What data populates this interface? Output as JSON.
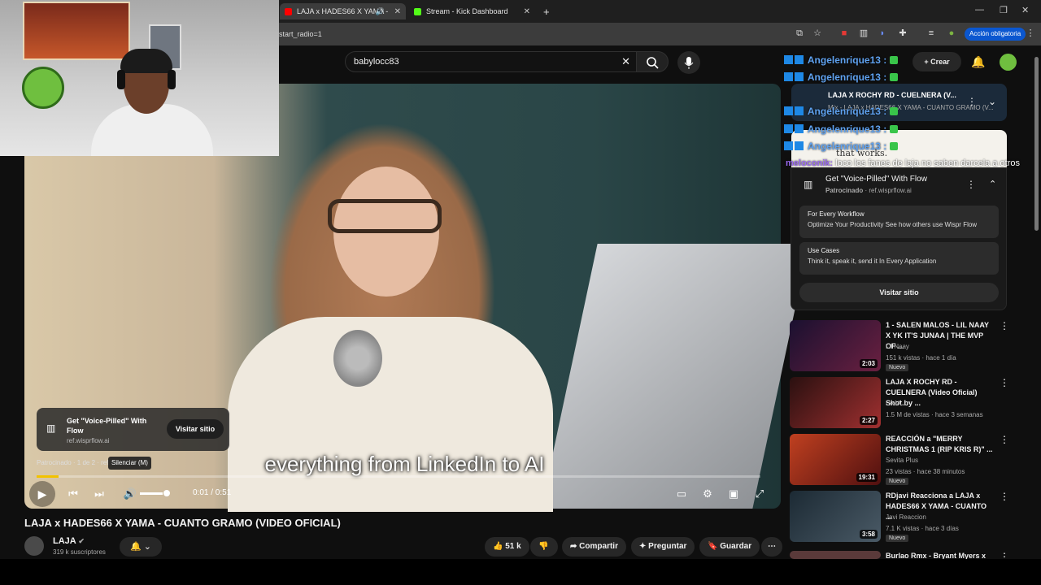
{
  "browser": {
    "tabs": [
      {
        "label": "LAJA x HADES66 X YAMA -",
        "active": true
      },
      {
        "label": "Stream - Kick Dashboard",
        "active": false
      }
    ],
    "url": "start_radio=1",
    "account_button": "Acción obligatoria"
  },
  "youtube": {
    "search_value": "babylocc83",
    "create_label": "Crear"
  },
  "player": {
    "caption": "everything from LinkedIn to AI",
    "time": "0:01 / 0:51",
    "progress": 0.03,
    "volume": 0.8,
    "tooltip": "Silenciar (M)",
    "sponsored_label": "Patrocinado · 1 de 2 · ref.wisprflow.ai",
    "ad_overlay": {
      "title": "Get \"Voice-Pilled\" With Flow",
      "url": "ref.wisprflow.ai",
      "button": "Visitar sitio"
    }
  },
  "video": {
    "title": "LAJA x HADES66 X YAMA - CUANTO GRAMO (VIDEO OFICIAL)",
    "channel": "LAJA",
    "subscribers": "319 k suscriptores",
    "likes": "51 k",
    "share": "Compartir",
    "ask": "Preguntar",
    "save": "Guardar"
  },
  "sidebar": {
    "now_playing": {
      "title": "LAJA X ROCHY RD - CUELNERA (V...",
      "subtitle": "Mix - LAJA x HADES66 X YAMA - CUANTO GRAMO (V..."
    },
    "ad_banner_text": "that works.",
    "ad_card": {
      "title": "Get \"Voice-Pilled\" With Flow",
      "sponsored": "Patrocinado",
      "domain": "ref.wisprflow.ai",
      "items": [
        {
          "title": "For Every Workflow",
          "desc": "Optimize Your Productivity See how others use Wispr Flow"
        },
        {
          "title": "Use Cases",
          "desc": "Think it, speak it, send it In Every Application"
        }
      ],
      "button": "Visitar sitio"
    },
    "recommendations": [
      {
        "title": "1 - SALEN MALOS - LIL NAAY X YK IT'S JUNAA | THE MVP OF ...",
        "channel": "Lil Naay",
        "meta": "151 k vistas · hace 1 día",
        "duration": "2:03",
        "badge": "Nuevo",
        "thumb": "#3b1d2e"
      },
      {
        "title": "LAJA X ROCHY RD - CUELNERA (Video Oficial) Shot.by ...",
        "channel": "LAJA",
        "meta": "1.5 M de vistas · hace 3 semanas",
        "duration": "2:27",
        "badge": "",
        "thumb": "#5a2020"
      },
      {
        "title": "REACCIÓN a \"MERRY CHRISTMAS 1 (RIP KRIS R)\" ...",
        "channel": "Sevita Plus",
        "meta": "23 vistas · hace 38 minutos",
        "duration": "19:31",
        "badge": "Nuevo",
        "thumb": "#8a2a1a"
      },
      {
        "title": "RDjavi Reacciona a LAJA x HADES66 X YAMA - CUANTO ...",
        "channel": "Javi Reaccion",
        "meta": "7.1 K vistas · hace 3 días",
        "duration": "3:58",
        "badge": "Nuevo",
        "thumb": "#2a3540"
      },
      {
        "title": "Burlao Rmx - Bryant Myers x",
        "channel": "",
        "meta": "",
        "duration": "",
        "badge": "",
        "thumb": "#3a2a2a"
      }
    ]
  },
  "chat": {
    "username": "Angelenrique13 :",
    "message_user": "meloconik:",
    "message_text": "loco los fanes de laja no saben darcela a otros"
  }
}
